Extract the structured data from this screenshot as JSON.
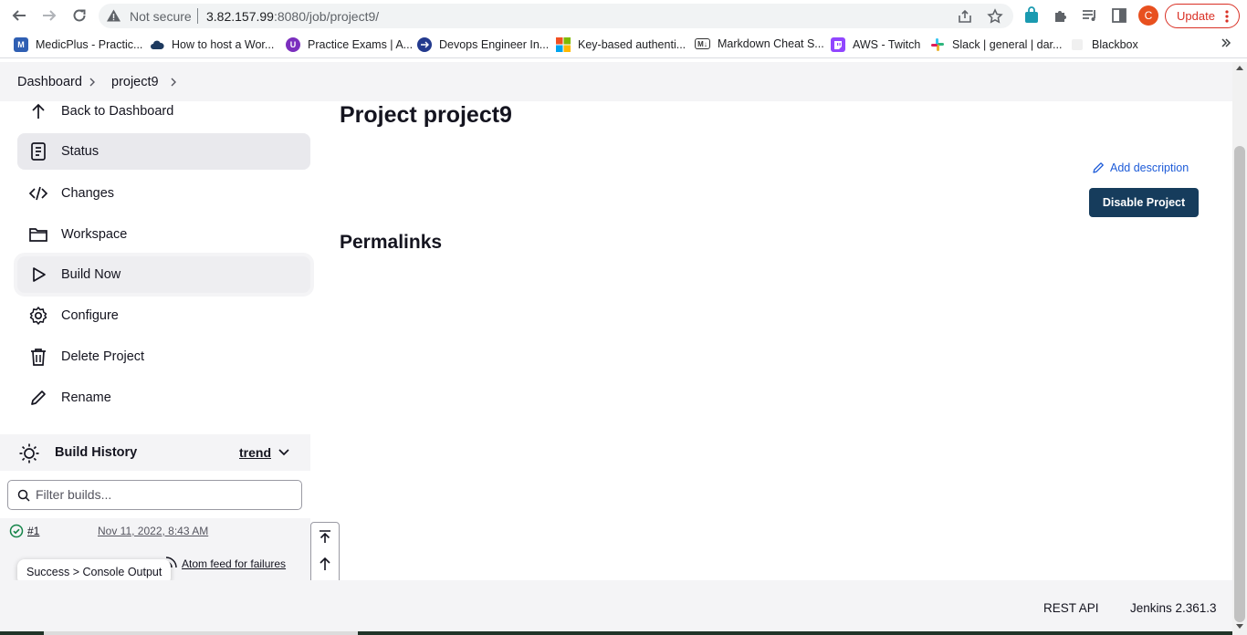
{
  "browser": {
    "security_label": "Not secure",
    "url_host": "3.82.157.99",
    "url_rest": ":8080/job/project9/",
    "avatar_letter": "C",
    "update_label": "Update",
    "bookmarks": [
      {
        "label": "MedicPlus - Practic...",
        "color": "#2f5fb3",
        "glyph": "M"
      },
      {
        "label": "How to host a Wor...",
        "color": "#1e3a5f",
        "glyph": ""
      },
      {
        "label": "Practice Exams | A...",
        "color": "#7b2fbe",
        "glyph": "U"
      },
      {
        "label": "Devops Engineer In...",
        "color": "#233a8e",
        "glyph": ""
      },
      {
        "label": "Key-based authenti...",
        "color": "#f25022",
        "glyph": ""
      },
      {
        "label": "Markdown Cheat S...",
        "color": "#333333",
        "glyph": "M"
      },
      {
        "label": "AWS - Twitch",
        "color": "#9146ff",
        "glyph": ""
      },
      {
        "label": "Slack | general | dar...",
        "color": "#e01e5a",
        "glyph": ""
      },
      {
        "label": "Blackbox",
        "color": "#e6e6e6",
        "glyph": ""
      }
    ]
  },
  "breadcrumb": {
    "items": [
      "Dashboard",
      "project9"
    ]
  },
  "sidebar": {
    "items": [
      {
        "label": "Back to Dashboard",
        "icon": "arrow-up-icon"
      },
      {
        "label": "Status",
        "icon": "document-icon"
      },
      {
        "label": "Changes",
        "icon": "code-icon"
      },
      {
        "label": "Workspace",
        "icon": "folder-icon"
      },
      {
        "label": "Build Now",
        "icon": "play-icon"
      },
      {
        "label": "Configure",
        "icon": "gear-icon"
      },
      {
        "label": "Delete Project",
        "icon": "trash-icon"
      },
      {
        "label": "Rename",
        "icon": "pencil-icon"
      }
    ]
  },
  "build_history": {
    "title": "Build History",
    "trend_label": "trend",
    "filter_placeholder": "Filter builds...",
    "builds": [
      {
        "number": "#1",
        "date": "Nov 11, 2022, 8:43 AM",
        "status": "success"
      }
    ],
    "feed_label": "Atom feed for failures",
    "tooltip": "Success > Console Output"
  },
  "main": {
    "title": "Project project9",
    "add_description": "Add description",
    "disable_button": "Disable Project",
    "permalinks_heading": "Permalinks"
  },
  "footer": {
    "rest_api": "REST API",
    "version": "Jenkins 2.361.3"
  },
  "colors": {
    "primary_button": "#163c5c",
    "link": "#1d5bd8",
    "success": "#138347",
    "update_red": "#d93025"
  }
}
